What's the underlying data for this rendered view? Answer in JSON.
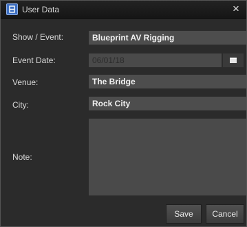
{
  "window": {
    "title": "User Data",
    "close_glyph": "×",
    "app_icon": "app-logo-icon"
  },
  "form": {
    "show_event": {
      "label": "Show / Event:",
      "value": "Blueprint AV Rigging"
    },
    "event_date": {
      "label": "Event Date:",
      "value": "06/01/18",
      "calendar_icon": "calendar-icon"
    },
    "venue": {
      "label": "Venue:",
      "value": "The Bridge"
    },
    "city": {
      "label": "City:",
      "value": "Rock City"
    },
    "note": {
      "label": "Note:",
      "value": ""
    }
  },
  "buttons": {
    "save": "Save",
    "cancel": "Cancel"
  },
  "colors": {
    "background": "#2b2b2b",
    "field": "#4d4d4d",
    "titlebar": "#1b1b1b",
    "text": "#d9d9d9",
    "accent_icon": "#3d6fc2"
  }
}
